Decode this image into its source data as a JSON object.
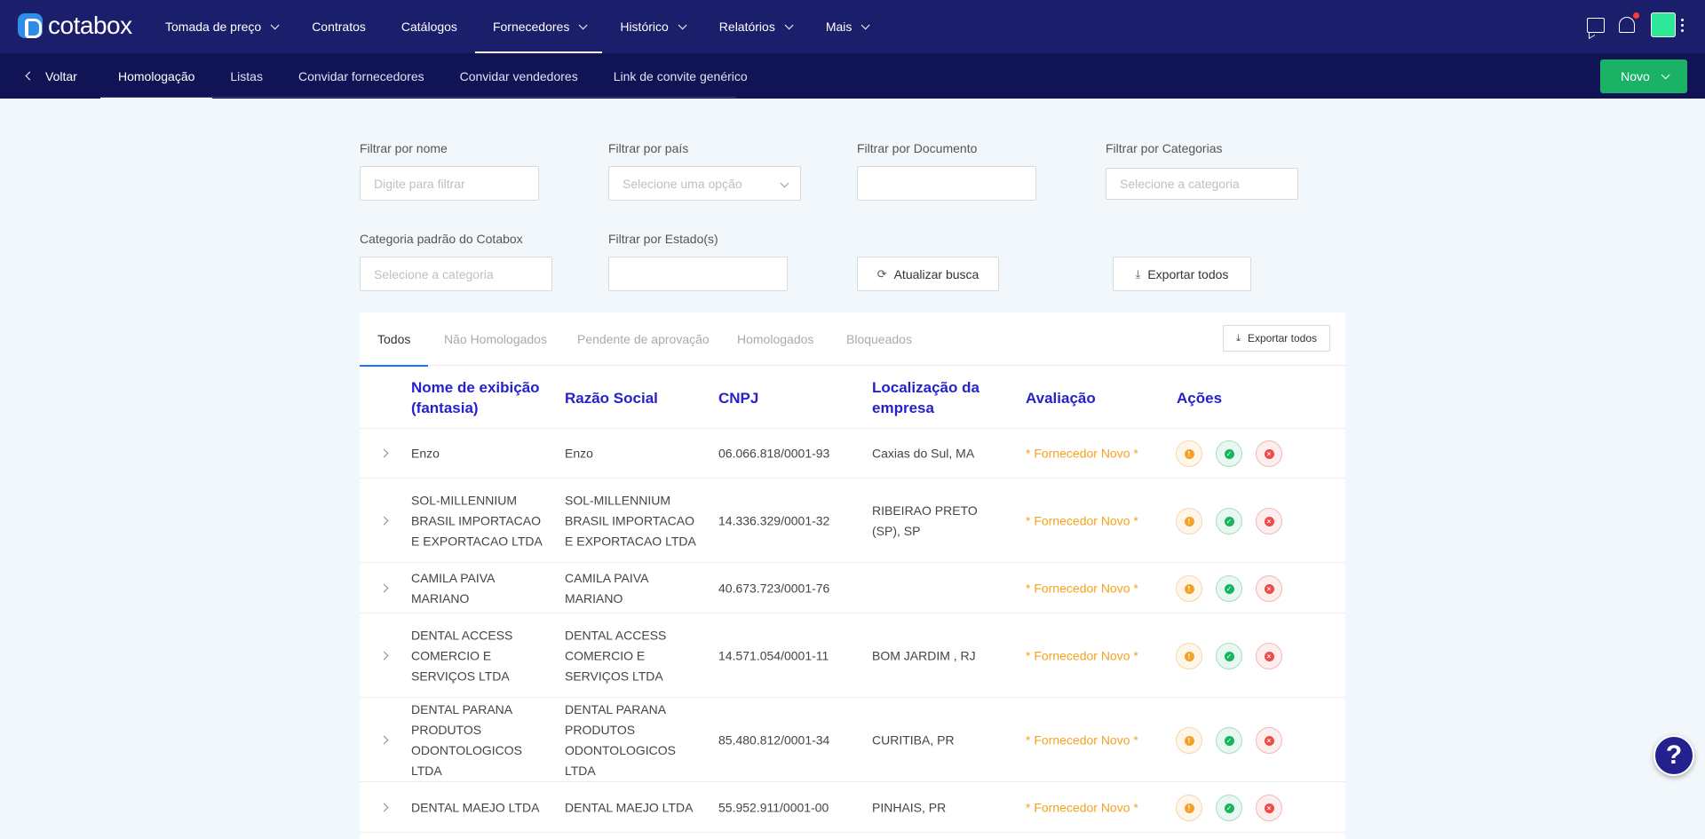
{
  "brand": {
    "name_part1": "cota",
    "name_part2": "box"
  },
  "topnav": {
    "items": [
      {
        "label": "Tomada de preço",
        "has_dropdown": true
      },
      {
        "label": "Contratos",
        "has_dropdown": false
      },
      {
        "label": "Catálogos",
        "has_dropdown": false
      },
      {
        "label": "Fornecedores",
        "has_dropdown": true,
        "active": true
      },
      {
        "label": "Histórico",
        "has_dropdown": true
      },
      {
        "label": "Relatórios",
        "has_dropdown": true
      },
      {
        "label": "Mais",
        "has_dropdown": true
      }
    ],
    "icons": [
      "chat-icon",
      "bell-icon",
      "avatar",
      "kebab-menu-icon"
    ],
    "avatar_color": "#2ee89a",
    "notification_dot_color": "#ff3b3b"
  },
  "subnav": {
    "back_label": "Voltar",
    "tabs": [
      {
        "label": "Homologação",
        "active": true
      },
      {
        "label": "Listas"
      },
      {
        "label": "Convidar fornecedores"
      },
      {
        "label": "Convidar vendedores"
      },
      {
        "label": "Link de convite genérico"
      }
    ],
    "new_button_label": "Novo"
  },
  "filters": {
    "name": {
      "label": "Filtrar por nome",
      "placeholder": "Digite para filtrar",
      "value": ""
    },
    "country": {
      "label": "Filtrar por país",
      "placeholder": "Selecione uma opção"
    },
    "document": {
      "label": "Filtrar por Documento",
      "value": ""
    },
    "categories": {
      "label": "Filtrar por Categorias",
      "placeholder": "Selecione a categoria"
    },
    "default_category": {
      "label": "Categoria padrão do Cotabox",
      "placeholder": "Selecione a categoria"
    },
    "state": {
      "label": "Filtrar por Estado(s)",
      "value": ""
    },
    "refresh_label": "Atualizar busca",
    "export_all_label": "Exportar todos"
  },
  "status_tabs": {
    "items": [
      {
        "label": "Todos",
        "active": true
      },
      {
        "label": "Não Homologados"
      },
      {
        "label": "Pendente de aprovação"
      },
      {
        "label": "Homologados"
      },
      {
        "label": "Bloqueados"
      }
    ],
    "export_label": "Exportar todos"
  },
  "table": {
    "headers": {
      "display_name": "Nome de exibição (fantasia)",
      "legal_name": "Razão Social",
      "cnpj": "CNPJ",
      "location": "Localização da empresa",
      "rating": "Avaliação",
      "actions": "Ações"
    },
    "rows": [
      {
        "display_name": "Enzo",
        "legal_name": "Enzo",
        "cnpj": "06.066.818/0001-93",
        "location": "Caxias do Sul, MA",
        "rating": "* Fornecedor Novo *"
      },
      {
        "display_name": "SOL-MILLENNIUM BRASIL IMPORTACAO E EXPORTACAO LTDA",
        "legal_name": "SOL-MILLENNIUM BRASIL IMPORTACAO E EXPORTACAO LTDA",
        "cnpj": "14.336.329/0001-32",
        "location": "RIBEIRAO PRETO (SP), SP",
        "rating": "* Fornecedor Novo *"
      },
      {
        "display_name": "CAMILA PAIVA MARIANO",
        "legal_name": "CAMILA PAIVA MARIANO",
        "cnpj": "40.673.723/0001-76",
        "location": "",
        "rating": "* Fornecedor Novo *"
      },
      {
        "display_name": "DENTAL ACCESS COMERCIO E SERVIÇOS LTDA",
        "legal_name": "DENTAL ACCESS COMERCIO E SERVIÇOS LTDA",
        "cnpj": "14.571.054/0001-11",
        "location": "BOM JARDIM , RJ",
        "rating": "* Fornecedor Novo *"
      },
      {
        "display_name": "DENTAL PARANA PRODUTOS ODONTOLOGICOS LTDA",
        "legal_name": "DENTAL PARANA PRODUTOS ODONTOLOGICOS LTDA",
        "cnpj": "85.480.812/0001-34",
        "location": "CURITIBA, PR",
        "rating": "* Fornecedor Novo *"
      },
      {
        "display_name": "DENTAL MAEJO LTDA",
        "legal_name": "DENTAL MAEJO LTDA",
        "cnpj": "55.952.911/0001-00",
        "location": "PINHAIS, PR",
        "rating": "* Fornecedor Novo *"
      }
    ],
    "action_icons": {
      "approve": "check-icon",
      "pending": "exclamation-icon",
      "block": "x-icon"
    },
    "colors": {
      "header": "#2622c9",
      "rating": "#f7a21c",
      "approve": "#17b461",
      "pending": "#f6a028",
      "block": "#ef4a4a"
    }
  },
  "help_button": {
    "label": "?"
  }
}
